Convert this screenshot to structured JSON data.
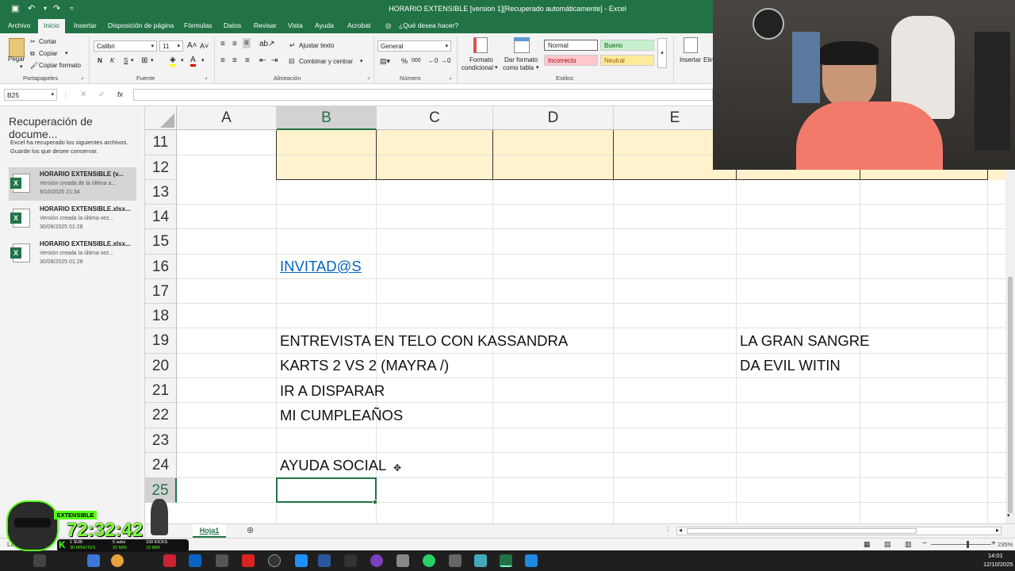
{
  "window": {
    "title": "HORARIO EXTENSIBLE [version 1][Recuperado automáticamente]  -  Excel"
  },
  "tabs": [
    "Archivo",
    "Inicio",
    "Insertar",
    "Disposición de página",
    "Fórmulas",
    "Datos",
    "Revisar",
    "Vista",
    "Ayuda",
    "Acrobat",
    "¿Qué desea hacer?"
  ],
  "ribbon": {
    "pegar": "Pegar",
    "cortar": "Cortar",
    "copiar": "Copiar",
    "copiar_formato": "Copiar formato",
    "portapapeles": "Portapapeles",
    "font_name": "Calibri",
    "font_size": "11",
    "fuente": "Fuente",
    "bold": "N",
    "italic": "K",
    "underline": "S",
    "ajustar": "Ajustar texto",
    "combinar": "Combinar y centrar",
    "alineacion": "Alineación",
    "number_format": "General",
    "numero": "Número",
    "percent": "%",
    "thousands": "000",
    "formato_cond": "Formato",
    "formato_cond2": "condicional",
    "dar_formato": "Dar formato",
    "dar_formato2": "como tabla",
    "styles": {
      "normal": "Normal",
      "bueno": "Bueno",
      "incorrecto": "Incorrecto",
      "neutral": "Neutral"
    },
    "estilos": "Estilos",
    "insertar": "Insertar",
    "eliminar": "Elim"
  },
  "formula_bar": {
    "name_box": "B25",
    "fx": "fx",
    "value": ""
  },
  "recovery": {
    "title": "Recuperación de docume...",
    "desc1": "Excel ha recuperado los siguientes archivos.",
    "desc2": "Guarde los que desee conservar.",
    "files": [
      {
        "name": "HORARIO EXTENSIBLE (v...",
        "desc": "Versión creada de la última a...",
        "date": "8/10/2025 21:34"
      },
      {
        "name": "HORARIO EXTENSIBLE.xlsx...",
        "desc": "Versión creada la última vez...",
        "date": "30/09/2025 01:28"
      },
      {
        "name": "HORARIO EXTENSIBLE.xlsx...",
        "desc": "Versión creada la última vez...",
        "date": "30/09/2025 01:28"
      }
    ]
  },
  "grid": {
    "columns": [
      "A",
      "B",
      "C",
      "D",
      "E"
    ],
    "rows": [
      "11",
      "12",
      "13",
      "14",
      "15",
      "16",
      "17",
      "18",
      "19",
      "20",
      "21",
      "22",
      "23",
      "24",
      "25"
    ],
    "cells": {
      "B16": "INVITAD@S",
      "B19": "ENTREVISTA EN TELO CON KASSANDRA",
      "B20": "KARTS 2 VS 2 (MAYRA /)",
      "B21": "IR A DISPARAR",
      "B22": "MI CUMPLEAÑOS",
      "B24": "AYUDA SOCIAL",
      "F19": "LA GRAN SANGRE",
      "F20": "DA EVIL WITIN"
    },
    "selected_cell": "B25"
  },
  "sheets": [
    "Hoja1"
  ],
  "status": {
    "left": "Listo",
    "zoom": "235%"
  },
  "clock": {
    "time": "14:01",
    "date": "12/10/2025"
  },
  "timer": {
    "label": "EXTENSIBLE",
    "time": "72:32:42",
    "sub1": "1 SUB",
    "sub2": "30 MINUTES",
    "sub3": "5 subs",
    "sub4": "20 MIN",
    "sub5": "100 KICKS",
    "sub6": "15 MIN"
  },
  "colors": {
    "excel_green": "#217346",
    "header_fill": "#fff2cc",
    "link": "#0563c1"
  }
}
